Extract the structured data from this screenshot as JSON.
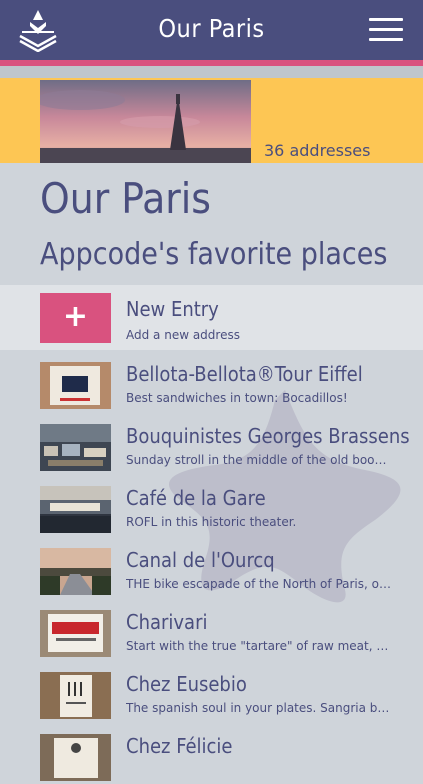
{
  "navbar": {
    "title": "Our Paris"
  },
  "hero": {
    "count_label": "36 addresses"
  },
  "page": {
    "title": "Our Paris",
    "subtitle": "Appcode's favorite places"
  },
  "new_entry": {
    "title": "New Entry",
    "subtitle": "Add a new address",
    "icon": "plus-icon"
  },
  "places": [
    {
      "title": "Bellota-Bellota®Tour Eiffel",
      "subtitle": "Best sandwiches in town: Bocadillos!"
    },
    {
      "title": "Bouquinistes Georges Brassens",
      "subtitle": "Sunday stroll in the middle of the old books an..."
    },
    {
      "title": "Café de la Gare",
      "subtitle": "ROFL in this historic theater."
    },
    {
      "title": "Canal de l'Ourcq",
      "subtitle": "THE bike escapade of the North of Paris, on th..."
    },
    {
      "title": "Charivari",
      "subtitle": "Start with the true \"tartare\" of raw meat, kni..."
    },
    {
      "title": "Chez Eusebio",
      "subtitle": "The spanish soul in your plates. Sangria bottle..."
    },
    {
      "title": "Chez Félicie",
      "subtitle": ""
    }
  ],
  "colors": {
    "navbar": "#4a4e7e",
    "accent_pink": "#d9527f",
    "hero_yellow": "#fdc654",
    "text": "#4a4e7e"
  }
}
